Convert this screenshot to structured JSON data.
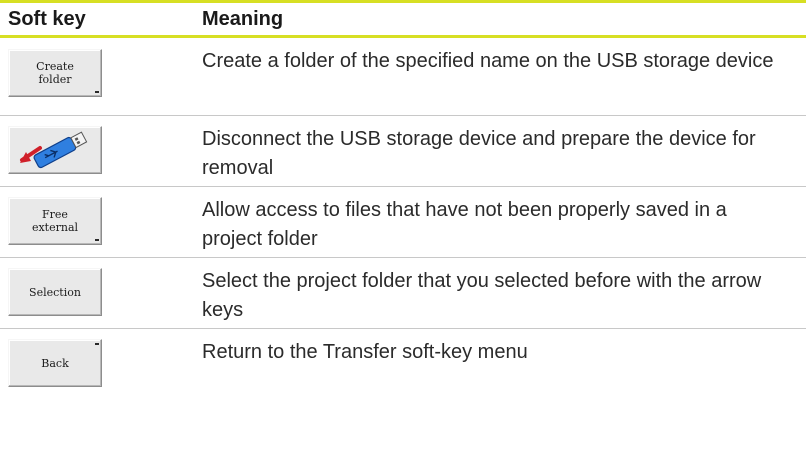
{
  "table": {
    "headers": {
      "softkey": "Soft key",
      "meaning": "Meaning"
    },
    "rows": [
      {
        "key_label": "Create\nfolder",
        "key_icon": null,
        "indicator": "bottom",
        "meaning": "Create a folder of the specified name on the USB storage device"
      },
      {
        "key_label": "",
        "key_icon": "usb-eject-icon",
        "indicator": "none",
        "meaning": "Disconnect the USB storage device and prepare the device for removal"
      },
      {
        "key_label": "Free\nexternal",
        "key_icon": null,
        "indicator": "bottom",
        "meaning": "Allow access to files that have not been properly saved in a project folder"
      },
      {
        "key_label": "Selection",
        "key_icon": null,
        "indicator": "none",
        "meaning": "Select the project folder that you selected before with the arrow keys"
      },
      {
        "key_label": "Back",
        "key_icon": null,
        "indicator": "top",
        "meaning": "Return to the Transfer soft-key menu"
      }
    ]
  },
  "colors": {
    "accent_rule": "#d7df23",
    "softkey_face": "#e9e9e9",
    "row_divider": "#c8c8c8",
    "usb_body": "#2f7fe0",
    "arrow_red": "#d0202a"
  }
}
